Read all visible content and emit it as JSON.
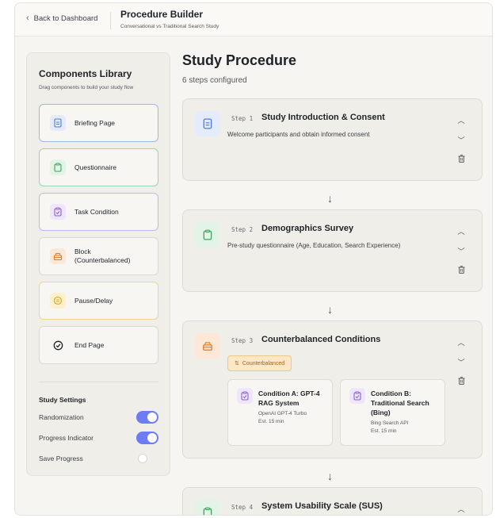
{
  "header": {
    "back_label": "Back to Dashboard",
    "title": "Procedure Builder",
    "subtitle": "Conversational vs Traditional Search Study"
  },
  "library": {
    "title": "Components Library",
    "subtitle": "Drag components to build your study flow",
    "items": [
      {
        "label": "Briefing Page",
        "icon": "document-icon",
        "color": "#4a7bdc"
      },
      {
        "label": "Questionnaire",
        "icon": "clipboard-icon",
        "color": "#3aa55a"
      },
      {
        "label": "Task Condition",
        "icon": "clipboard-check-icon",
        "color": "#8b5cd6"
      },
      {
        "label": "Block (Counterbalanced)",
        "icon": "layers-icon",
        "color": "#e07a2c"
      },
      {
        "label": "Pause/Delay",
        "icon": "pause-icon",
        "color": "#e0a61c"
      },
      {
        "label": "End Page",
        "icon": "check-circle-icon",
        "color": "#1f2328"
      }
    ]
  },
  "settings": {
    "title": "Study Settings",
    "rows": [
      {
        "label": "Randomization",
        "enabled": true
      },
      {
        "label": "Progress Indicator",
        "enabled": true
      },
      {
        "label": "Save Progress",
        "enabled": false
      }
    ]
  },
  "main": {
    "title": "Study Procedure",
    "subtitle": "6 steps configured"
  },
  "steps": [
    {
      "step_label": "Step 1",
      "title": "Study Introduction & Consent",
      "description": "Welcome participants and obtain informed consent"
    },
    {
      "step_label": "Step 2",
      "title": "Demographics Survey",
      "description": "Pre-study questionnaire (Age, Education, Search Experience)"
    },
    {
      "step_label": "Step 3",
      "title": "Counterbalanced Conditions",
      "badge": "Counterbalanced",
      "conditions": [
        {
          "title": "Condition A: GPT-4 RAG System",
          "meta1": "OpenAI GPT-4 Turbo",
          "meta2": "Est. 15 min"
        },
        {
          "title": "Condition B: Traditional Search (Bing)",
          "meta1": "Bing Search API",
          "meta2": "Est. 15 min"
        }
      ]
    },
    {
      "step_label": "Step 4",
      "title": "System Usability Scale (SUS)"
    }
  ],
  "colors": {
    "accent": "#6d7cf5",
    "blue": "#4a7bdc",
    "green": "#3aa55a",
    "purple": "#8b5cd6",
    "orange": "#e07a2c",
    "yellow": "#e0a61c"
  }
}
